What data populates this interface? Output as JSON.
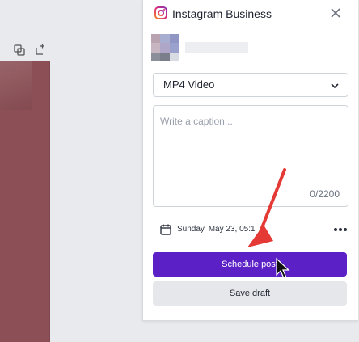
{
  "toolbar": {
    "icons": [
      "duplicate-icon",
      "add-page-icon"
    ]
  },
  "panel": {
    "title": "Instagram Business",
    "close_icon": "close-icon",
    "format_select": {
      "value": "MP4 Video"
    },
    "caption": {
      "placeholder": "Write a caption...",
      "counter": "0/2200"
    },
    "schedule": {
      "datetime": "Sunday, May 23, 05:1",
      "more_icon": "more-horizontal-icon"
    },
    "schedule_button": "Schedule post",
    "save_draft_button": "Save draft"
  },
  "colors": {
    "primary": "#5b21c6",
    "page_thumb": "#8b4f55",
    "annotation_arrow": "#e53935"
  }
}
